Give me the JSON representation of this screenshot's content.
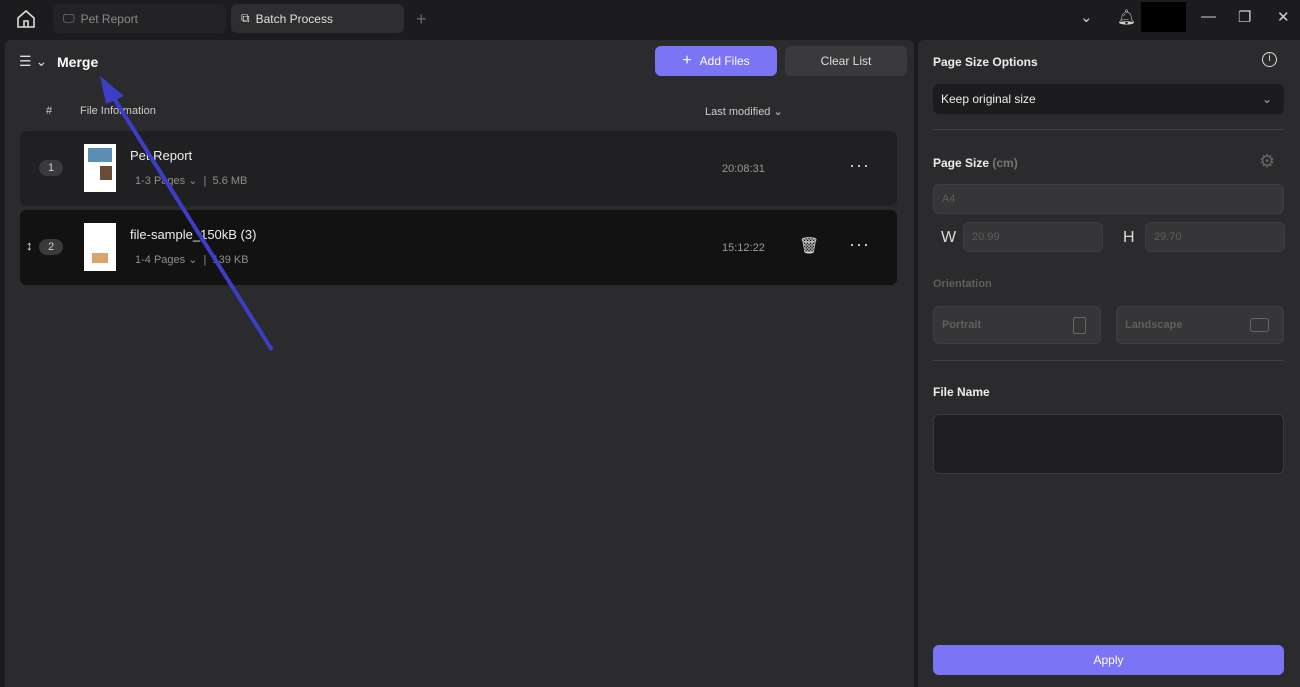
{
  "tabs": [
    {
      "label": "Pet Report",
      "icon": "monitor-icon"
    },
    {
      "label": "Batch Process",
      "icon": "batch-icon"
    }
  ],
  "main": {
    "title": "Merge",
    "add_files": "Add Files",
    "clear_list": "Clear List",
    "columns": {
      "num": "#",
      "info": "File Information",
      "modified": "Last modified"
    },
    "files": [
      {
        "num": "1",
        "name": "Pet Report",
        "pages": "1-3 Pages",
        "size": "5.6 MB",
        "time": "20:08:31"
      },
      {
        "num": "2",
        "name": "file-sample_150kB (3)",
        "pages": "1-4 Pages",
        "size": "139 KB",
        "time": "15:12:22"
      }
    ]
  },
  "side": {
    "page_size_options": "Page Size Options",
    "size_option": "Keep original size",
    "page_size": "Page Size",
    "unit": "(cm)",
    "paper": "A4",
    "w_label": "W",
    "w_value": "20.99",
    "h_label": "H",
    "h_value": "29.70",
    "orientation": "Orientation",
    "portrait": "Portrait",
    "landscape": "Landscape",
    "file_name": "File Name",
    "file_name_value": "",
    "apply": "Apply"
  },
  "colors": {
    "accent": "#7b74f5",
    "annotation_arrow": "#3a3fc6"
  }
}
